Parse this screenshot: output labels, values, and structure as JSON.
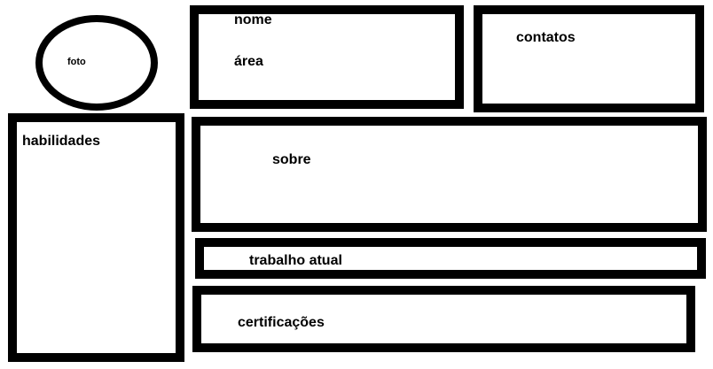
{
  "photo": {
    "label": "foto"
  },
  "identity": {
    "name_label": "nome",
    "area_label": "área"
  },
  "contacts": {
    "label": "contatos"
  },
  "skills": {
    "label": "habilidades"
  },
  "about": {
    "label": "sobre"
  },
  "current_job": {
    "label": "trabalho atual"
  },
  "certifications": {
    "label": "certificações"
  },
  "colors": {
    "stroke": "#000000",
    "background": "#ffffff"
  }
}
